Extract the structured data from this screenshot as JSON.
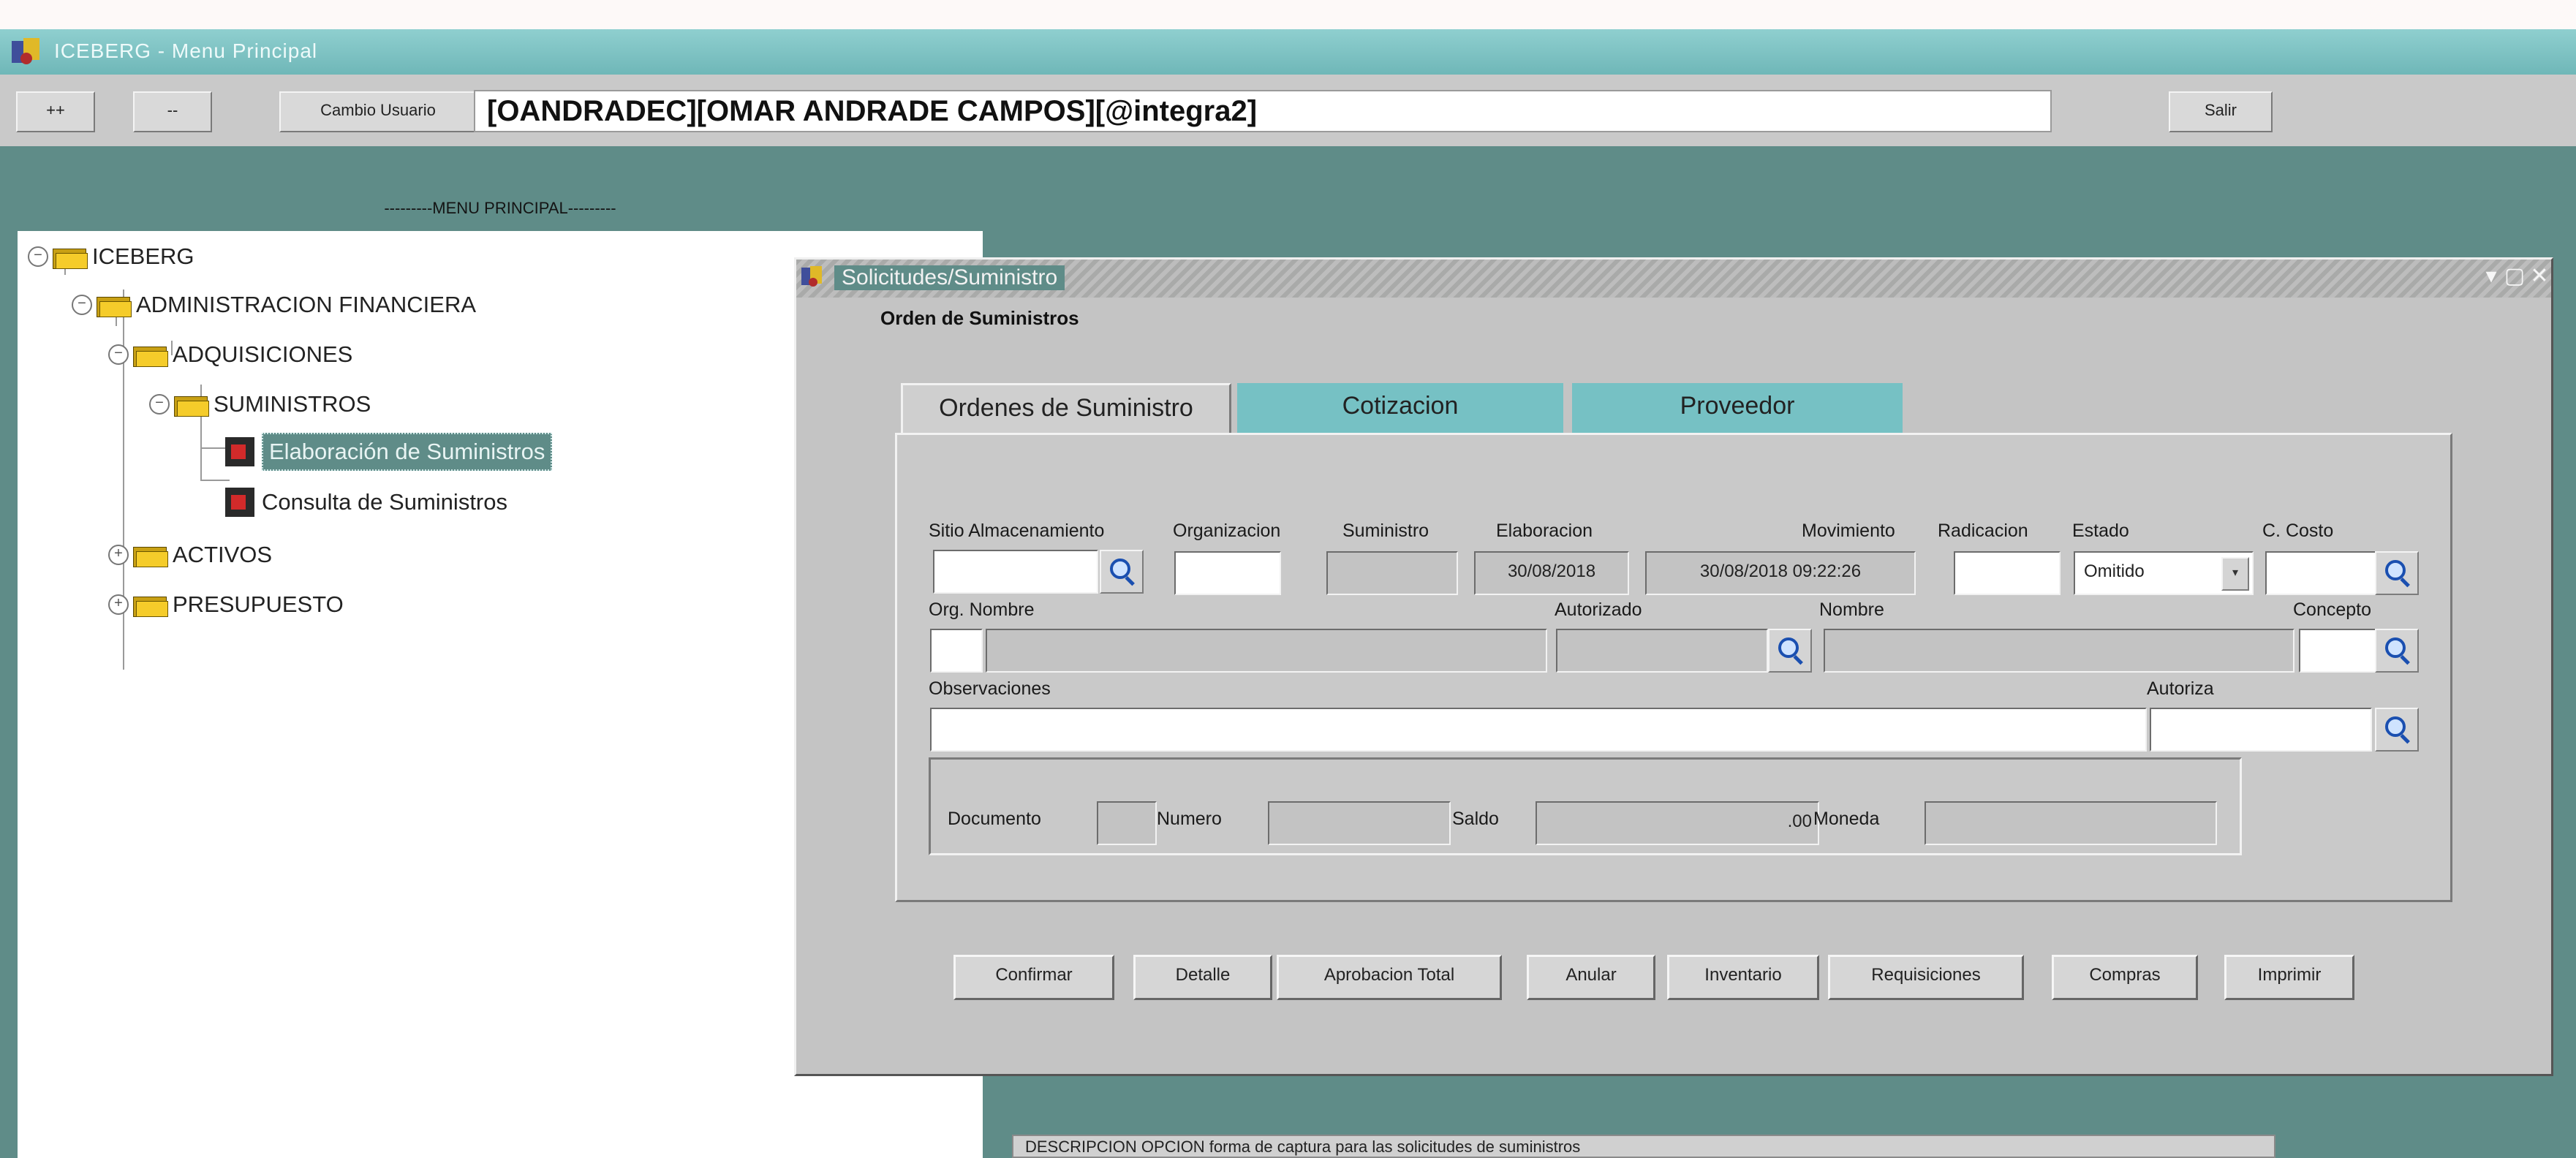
{
  "window": {
    "title": "ICEBERG - Menu Principal",
    "colors": {
      "titlebar": "#7bc1c2",
      "mdi_background": "#5f8c88",
      "tab_inactive": "#76c1c4"
    }
  },
  "toolbar": {
    "expand_label": "++",
    "collapse_label": "--",
    "change_user_label": "Cambio Usuario",
    "user_value": "[OANDRADEC][OMAR ANDRADE CAMPOS][@integra2]",
    "exit_label": "Salir"
  },
  "menu": {
    "caption": "---------MENU PRINCIPAL---------"
  },
  "tree": {
    "root": "ICEBERG",
    "admin": "ADMINISTRACION FINANCIERA",
    "adquisiciones": "ADQUISICIONES",
    "suministros": "SUMINISTROS",
    "elaboracion": "Elaboración de Suministros",
    "consulta": "Consulta de Suministros",
    "activos": "ACTIVOS",
    "presupuesto": "PRESUPUESTO",
    "icons": [
      "folder-icon",
      "form-icon",
      "tree-toggle-icon"
    ]
  },
  "form": {
    "title": "Solicitudes/Suministro",
    "subtitle": "Orden de Suministros",
    "tabs": [
      "Ordenes de Suministro",
      "Cotizacion",
      "Proveedor"
    ],
    "labels": {
      "sitio": "Sitio Almacenamiento",
      "organizacion": "Organizacion",
      "suministro": "Suministro",
      "elaboracion": "Elaboracion",
      "movimiento": "Movimiento",
      "radicacion": "Radicacion",
      "estado": "Estado",
      "c_costo": "C. Costo",
      "org_nombre": "Org. Nombre",
      "autorizado": "Autorizado",
      "nombre": "Nombre",
      "concepto": "Concepto",
      "observaciones": "Observaciones",
      "autoriza": "Autoriza",
      "documento": "Documento",
      "numero": "Numero",
      "saldo": "Saldo",
      "moneda": "Moneda"
    },
    "values": {
      "elaboracion": "30/08/2018",
      "movimiento": "30/08/2018 09:22:26",
      "estado": "Omitido",
      "saldo": ".00"
    },
    "buttons": [
      "Confirmar",
      "Detalle",
      "Aprobacion Total",
      "Anular",
      "Inventario",
      "Requisiciones",
      "Compras",
      "Imprimir"
    ]
  },
  "description": {
    "text": "DESCRIPCION OPCION    forma de captura para las solicitudes de suministros"
  }
}
